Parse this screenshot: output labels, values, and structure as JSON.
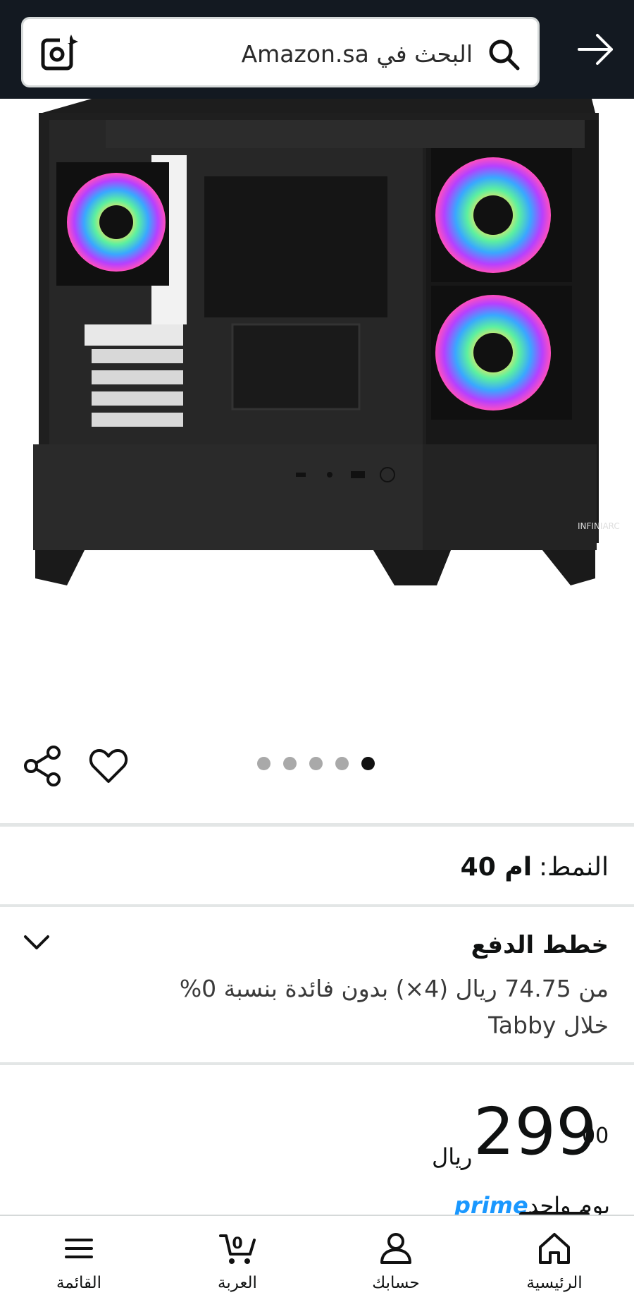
{
  "search": {
    "placeholder": "البحث في Amazon.sa"
  },
  "gallery": {
    "image_count": 5,
    "active_index": 4
  },
  "style": {
    "label": "النمط:",
    "value": "ام 40"
  },
  "payment": {
    "title": "خطط الدفع",
    "line1": "من 74.75 ريال (4×) بدون فائدة بنسبة 0%",
    "line2": "خلال Tabby"
  },
  "price": {
    "currency": "ريال",
    "whole": "299",
    "fraction": "00"
  },
  "prime": {
    "logo": "prime",
    "text": "يوم واحد"
  },
  "nav": {
    "home": "الرئيسية",
    "account": "حسابك",
    "cart": "العربة",
    "cart_count": "0",
    "menu": "القائمة"
  },
  "colors": {
    "topbar": "#131921",
    "prime_blue": "#1a98ff",
    "text": "#0f1111"
  },
  "icons": [
    "camera-search-icon",
    "search-icon",
    "back-arrow-icon",
    "share-icon",
    "heart-icon",
    "chevron-down-icon",
    "home-icon",
    "account-icon",
    "cart-icon",
    "menu-icon"
  ]
}
